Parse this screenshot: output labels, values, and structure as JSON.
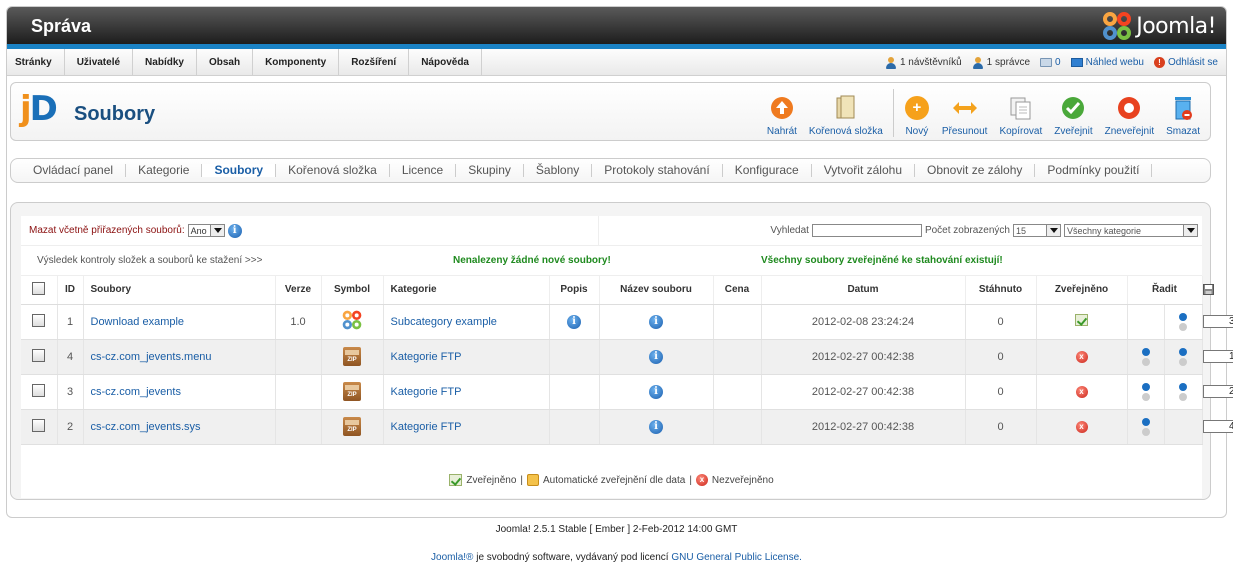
{
  "header": {
    "title": "Správa",
    "logo_text": "Joomla!"
  },
  "menu": {
    "items": [
      "Stránky",
      "Uživatelé",
      "Nabídky",
      "Obsah",
      "Komponenty",
      "Rozšíření",
      "Nápověda"
    ]
  },
  "status": {
    "visitors": "1 návštěvníků",
    "admins": "1 správce",
    "messages": "0",
    "preview": "Náhled webu",
    "logout": "Odhlásit se"
  },
  "toolbar": {
    "logo_j": "j",
    "logo_d": "D",
    "page_title": "Soubory",
    "buttons": [
      "Nahrát",
      "Kořenová složka",
      "Nový",
      "Přesunout",
      "Kopírovat",
      "Zveřejnit",
      "Zneveřejnit",
      "Smazat"
    ]
  },
  "tabs": [
    "Ovládací panel",
    "Kategorie",
    "Soubory",
    "Kořenová složka",
    "Licence",
    "Skupiny",
    "Šablony",
    "Protokoly stahování",
    "Konfigurace",
    "Vytvořit zálohu",
    "Obnovit ze zálohy",
    "Podmínky použití"
  ],
  "filters": {
    "delete_label": "Mazat včetně přiřazených souborů:",
    "delete_value": "Ano",
    "search_label": "Vyhledat",
    "count_label": "Počet zobrazených",
    "count_value": "15",
    "category_value": "Všechny kategorie"
  },
  "check": {
    "result_label": "Výsledek kontroly složek a souborů ke stažení >>>",
    "no_new": "Nenalezeny žádné nové soubory!",
    "all_exist": "Všechny soubory zveřejněné ke stahování existují!"
  },
  "columns": [
    "ID",
    "Soubory",
    "Verze",
    "Symbol",
    "Kategorie",
    "Popis",
    "Název souboru",
    "Cena",
    "Datum",
    "Stáhnuto",
    "Zveřejněno",
    "Řadit"
  ],
  "rows": [
    {
      "id": "1",
      "name": "Download example",
      "version": "1.0",
      "symbol": "joomla",
      "category": "Subcategory example",
      "desc": true,
      "date": "2012-02-08 23:24:24",
      "downloads": "0",
      "published": true,
      "up": false,
      "down": true,
      "order": "3"
    },
    {
      "id": "4",
      "name": "cs-cz.com_jevents.menu",
      "version": "",
      "symbol": "zip",
      "category": "Kategorie FTP",
      "desc": false,
      "date": "2012-02-27 00:42:38",
      "downloads": "0",
      "published": false,
      "up": true,
      "down": true,
      "order": "1"
    },
    {
      "id": "3",
      "name": "cs-cz.com_jevents",
      "version": "",
      "symbol": "zip",
      "category": "Kategorie FTP",
      "desc": false,
      "date": "2012-02-27 00:42:38",
      "downloads": "0",
      "published": false,
      "up": true,
      "down": true,
      "order": "2"
    },
    {
      "id": "2",
      "name": "cs-cz.com_jevents.sys",
      "version": "",
      "symbol": "zip",
      "category": "Kategorie FTP",
      "desc": false,
      "date": "2012-02-27 00:42:38",
      "downloads": "0",
      "published": false,
      "up": true,
      "down": false,
      "order": "4"
    }
  ],
  "icon_labels": {
    "info": "i",
    "zip": "ZIP",
    "unpublished": "x",
    "logout": "!"
  },
  "legend": {
    "published": "Zveřejněno",
    "sep": "|",
    "auto": "Automatické zveřejnění dle data",
    "unpublished": "Nezveřejněno"
  },
  "footer": {
    "version": "Joomla! 2.5.1 Stable [ Ember ] 2-Feb-2012 14:00 GMT",
    "joomla": "Joomla!®",
    "mid": " je svobodný software, vydávaný pod licencí ",
    "license": "GNU General Public License."
  },
  "colors": {
    "accent": "#1a82c4",
    "link": "#1a5ea6",
    "success": "#1f8a1f",
    "danger": "#8b1010"
  }
}
